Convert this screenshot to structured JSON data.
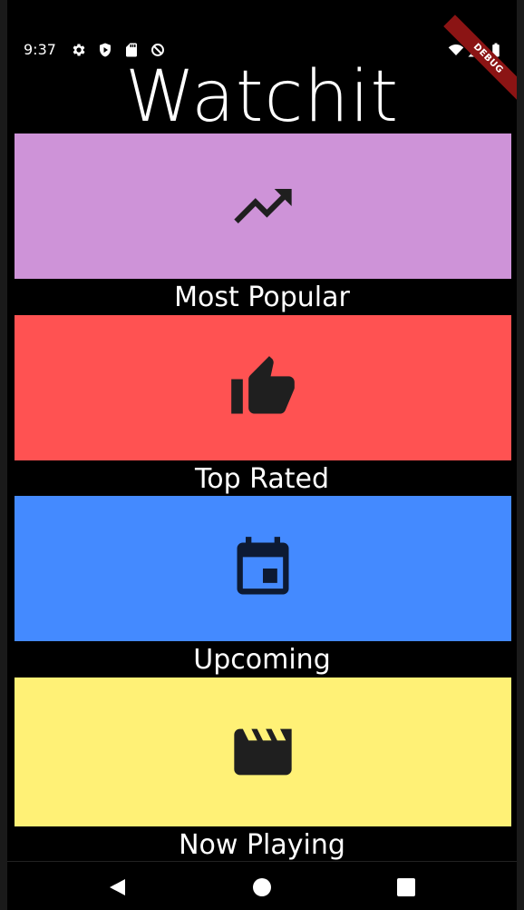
{
  "status_bar": {
    "time": "9:37",
    "icons": [
      "gear-icon",
      "shield-icon",
      "sd-card-icon",
      "no-sync-icon",
      "wifi-icon",
      "signal-icon",
      "battery-icon"
    ],
    "debug_label": "DEBUG"
  },
  "app": {
    "title": "Watchit"
  },
  "categories": [
    {
      "label": "Most Popular",
      "icon": "trending-up-icon",
      "color": "#ce93d8"
    },
    {
      "label": "Top Rated",
      "icon": "thumb-up-icon",
      "color": "#ff5252"
    },
    {
      "label": "Upcoming",
      "icon": "calendar-icon",
      "color": "#448aff"
    },
    {
      "label": "Now Playing",
      "icon": "movie-clapper-icon",
      "color": "#fff176"
    }
  ],
  "nav": {
    "buttons": [
      "back-icon",
      "home-icon",
      "recents-icon"
    ]
  }
}
